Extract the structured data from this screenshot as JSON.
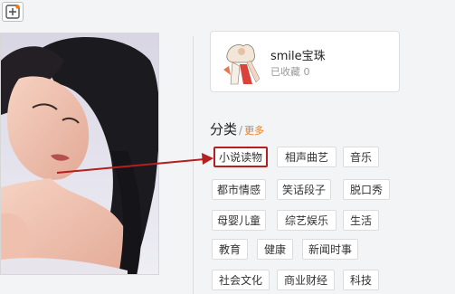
{
  "toolbar": {
    "add_icon": "add-square-icon"
  },
  "user_card": {
    "name": "smile宝珠",
    "favorites": "已收藏 0",
    "avatar_icon": "illustrated-avatar"
  },
  "categories": {
    "title": "分类",
    "slash": "/",
    "more_label": "更多",
    "tags": [
      "小说读物",
      "相声曲艺",
      "音乐",
      "都市情感",
      "笑话段子",
      "脱口秀",
      "母婴儿童",
      "综艺娱乐",
      "生活",
      "教育",
      "健康",
      "新闻时事",
      "社会文化",
      "商业财经",
      "科技"
    ],
    "highlighted": "小说读物"
  },
  "colors": {
    "accent_orange": "#e97b1a",
    "highlight_red": "#b51f1f",
    "background": "#f3f4f6"
  }
}
